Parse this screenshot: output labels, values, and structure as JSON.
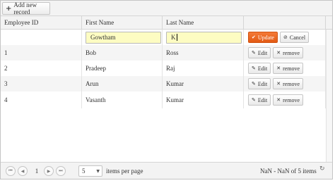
{
  "toolbar": {
    "add_label": "Add new record",
    "add_icon": "plus-icon"
  },
  "columns": [
    "Employee ID",
    "First Name",
    "Last Name",
    ""
  ],
  "edit_row": {
    "first_name": "Gowtham",
    "last_name": "K",
    "update_label": "Update",
    "cancel_label": "Cancel"
  },
  "rows": [
    {
      "id": "1",
      "first": "Bob",
      "last": "Ross"
    },
    {
      "id": "2",
      "first": "Pradeep",
      "last": "Raj"
    },
    {
      "id": "3",
      "first": "Arun",
      "last": "Kumar"
    },
    {
      "id": "4",
      "first": "Vasanth",
      "last": "Kumar"
    }
  ],
  "row_actions": {
    "edit_label": "Edit",
    "remove_label": "remove"
  },
  "pager": {
    "current_page": "1",
    "page_size": "5",
    "items_per_page_label": "items per page",
    "info": "NaN - NaN of 5 items"
  },
  "colors": {
    "accent": "#e8601c",
    "edit_bg": "#fdfcc2",
    "header_bg": "#f3f3f3"
  }
}
